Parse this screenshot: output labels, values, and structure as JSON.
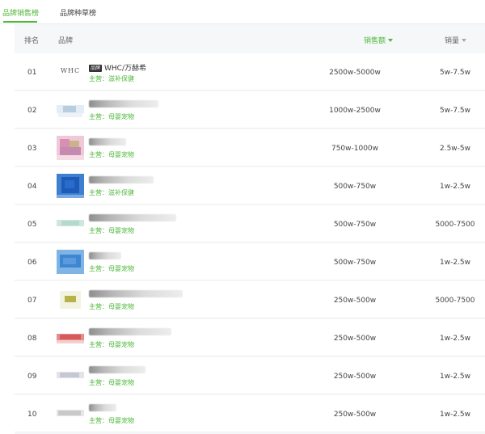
{
  "tabs": [
    {
      "label": "品牌销售榜",
      "active": true
    },
    {
      "label": "品牌种草榜",
      "active": false
    }
  ],
  "accent_color": "#4fb83a",
  "table": {
    "headers": {
      "rank": "排名",
      "brand": "品牌",
      "sales": "销售额",
      "volume": "销量"
    },
    "rows": [
      {
        "rank": "01",
        "badge": "品牌",
        "brand_name": "WHC/万赫希",
        "logo_text": "WHC",
        "main": "主营：滋补保健",
        "sales": "2500w-5000w",
        "volume": "5w-7.5w"
      },
      {
        "rank": "02",
        "main": "主营：母婴宠物",
        "sales": "1000w-2500w",
        "volume": "5w-7.5w"
      },
      {
        "rank": "03",
        "main": "主营：母婴宠物",
        "sales": "750w-1000w",
        "volume": "2.5w-5w"
      },
      {
        "rank": "04",
        "main": "主营：滋补保健",
        "sales": "500w-750w",
        "volume": "1w-2.5w"
      },
      {
        "rank": "05",
        "main": "主营：母婴宠物",
        "sales": "500w-750w",
        "volume": "5000-7500"
      },
      {
        "rank": "06",
        "main": "主营：母婴宠物",
        "sales": "500w-750w",
        "volume": "1w-2.5w"
      },
      {
        "rank": "07",
        "main": "主营：母婴宠物",
        "sales": "250w-500w",
        "volume": "5000-7500"
      },
      {
        "rank": "08",
        "main": "主营：母婴宠物",
        "sales": "250w-500w",
        "volume": "1w-2.5w"
      },
      {
        "rank": "09",
        "main": "主营：母婴宠物",
        "sales": "250w-500w",
        "volume": "1w-2.5w"
      },
      {
        "rank": "10",
        "main": "主营：母婴宠物",
        "sales": "250w-500w",
        "volume": "1w-2.5w"
      }
    ]
  }
}
